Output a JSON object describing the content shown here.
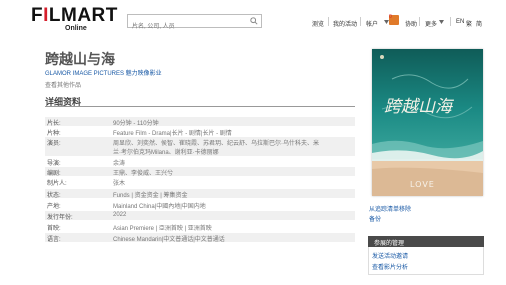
{
  "header": {
    "logo": {
      "prefix": "F",
      "accent": "I",
      "rest": "LMART",
      "sub": "Online"
    },
    "search_placeholder": "片名, 公司, 人员",
    "nav": [
      "测览",
      "我的活动",
      "帐户",
      "协助",
      "更多"
    ],
    "badge_count": "0",
    "lang": [
      "EN",
      "繁",
      "简"
    ]
  },
  "film": {
    "title": "跨越山与海",
    "company": "GLAMOR IMAGE PICTURES 魅力映像影业",
    "company_sub": "查看其他作品"
  },
  "section_title": "详细资料",
  "details": [
    {
      "key": "片长:",
      "value": "90分钟 - 110分钟"
    },
    {
      "key": "片种:",
      "value": "Feature Film - Drama|长片 - 剧情|长片 - 剧情"
    },
    {
      "key": "演员:",
      "value": "周显欣、刘奕然、侯智、崔晓霞、苏君玥、纪云舒、乌拉斯巴尔·乌什科夫、米"
    },
    {
      "key": "",
      "value": "兰·考尔伯克玛Milana、谢利亚·卡德丽娜"
    },
    {
      "key": "导演:",
      "value": "余涛"
    },
    {
      "key": "编剧:",
      "value": "王鼎、李俊威、王兴兮"
    },
    {
      "key": "制片人:",
      "value": "张木"
    },
    {
      "key": "状态:",
      "value": "Funds | 资金资金 | 筹集资金"
    },
    {
      "key": "产地:",
      "value": "Mainland China|中國內地|中国内地"
    },
    {
      "key": "发行年份:",
      "value": "2022"
    },
    {
      "key": "首映:",
      "value": "Asian Premiere | 亞洲首映 | 亚洲首映"
    },
    {
      "key": "语言:",
      "value": "Chinese Mandarin|中文普通话|中文普通话"
    }
  ],
  "poster": {
    "text": "跨越山海",
    "tag": "LOVE",
    "alt": "film poster"
  },
  "sidebar": {
    "links": [
      "从追踪清单移除",
      "备份"
    ],
    "panel_title": "参展的管理",
    "panel_links": [
      "发送活动邀请",
      "查看影片分析"
    ]
  },
  "colors": {
    "accent_red": "#d61f2c",
    "link_blue": "#1a5aa6",
    "panel_dark": "#4a4a4a"
  }
}
